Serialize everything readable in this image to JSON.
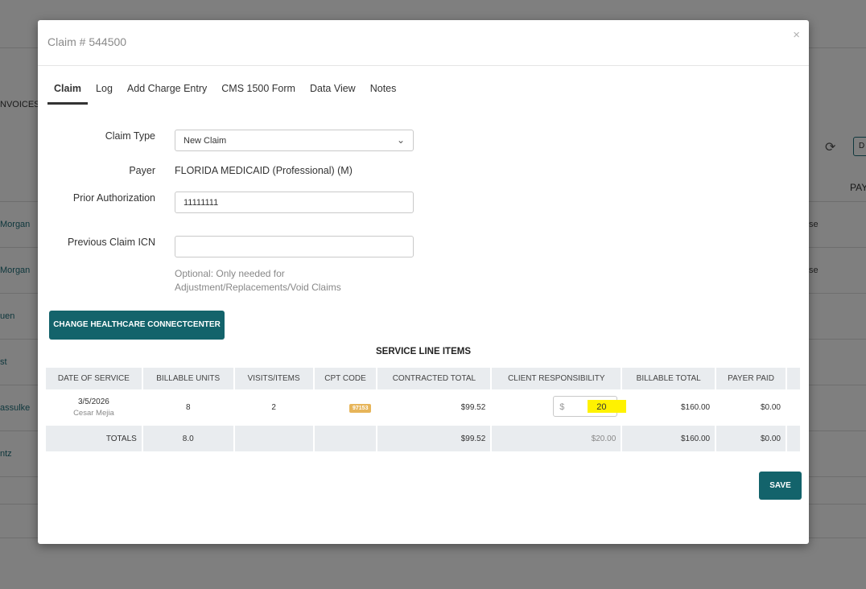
{
  "background": {
    "invoices_tab": "NVOICES",
    "pay_header": "PAY",
    "btn_partial": "D",
    "rows": [
      {
        "left": "Morgan",
        "right": "se"
      },
      {
        "left": "Morgan",
        "right": "se"
      },
      {
        "left": "uen",
        "right": ""
      },
      {
        "left": "st",
        "right": ""
      },
      {
        "left": "assulke",
        "right": ""
      },
      {
        "left": "ntz",
        "right": ""
      }
    ]
  },
  "modal": {
    "title": "Claim # 544500",
    "close": "×",
    "tabs": [
      {
        "label": "Claim",
        "active": true
      },
      {
        "label": "Log"
      },
      {
        "label": "Add Charge Entry"
      },
      {
        "label": "CMS 1500 Form"
      },
      {
        "label": "Data View"
      },
      {
        "label": "Notes"
      }
    ],
    "form": {
      "claim_type_label": "Claim Type",
      "claim_type_value": "New Claim",
      "payer_label": "Payer",
      "payer_value": "FLORIDA MEDICAID (Professional) (M)",
      "prior_auth_label": "Prior Authorization",
      "prior_auth_value": "11111111",
      "prev_icn_label": "Previous Claim ICN",
      "prev_icn_value": "",
      "help_line1": "Optional: Only needed for",
      "help_line2": "Adjustment/Replacements/Void Claims"
    },
    "change_button": "CHANGE HEALTHCARE CONNECTCENTER",
    "section_title": "SERVICE LINE ITEMS",
    "table": {
      "headers": [
        "DATE OF SERVICE",
        "BILLABLE UNITS",
        "VISITS/ITEMS",
        "CPT CODE",
        "CONTRACTED TOTAL",
        "CLIENT RESPONSIBILITY",
        "BILLABLE TOTAL",
        "PAYER PAID"
      ],
      "row": {
        "date": "3/5/2026",
        "provider": "Cesar Mejia",
        "units": "8",
        "visits": "2",
        "cpt": "97153",
        "contracted": "$99.52",
        "currency": "$",
        "client_resp": "20",
        "billable": "$160.00",
        "payer_paid": "$0.00"
      },
      "totals": {
        "label": "TOTALS",
        "units": "8.0",
        "contracted": "$99.52",
        "client_resp": "$20.00",
        "billable": "$160.00",
        "payer_paid": "$0.00"
      }
    },
    "save_button": "SAVE"
  }
}
